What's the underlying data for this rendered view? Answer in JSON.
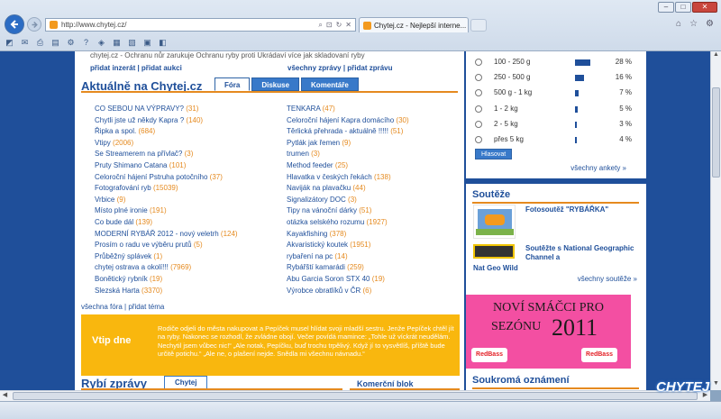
{
  "browser": {
    "url": "http://www.chytej.cz/",
    "tab_title": "Chytej.cz - Nejlepší interne...",
    "tab_close": "×",
    "win_min": "–",
    "win_max": "□",
    "win_close": "✕"
  },
  "main": {
    "top_strip": "chytej.cz - Ochranu nůr zarukuje Ochranu ryby proti Ukrádaví více jak skladovaní ryby",
    "top_left_links": "přidat inzerát | přidat aukci",
    "top_right_links": "všechny zprávy | přidat zprávu",
    "section_title": "Aktuálně na Chytej.cz",
    "tabs": [
      {
        "label": "Fóra"
      },
      {
        "label": "Diskuse"
      },
      {
        "label": "Komentáře"
      }
    ],
    "topics_left": [
      {
        "t": "CO SEBOU NA VÝPRAVY?",
        "c": "(31)"
      },
      {
        "t": "Chytli jste už někdy Kapra ?",
        "c": "(140)"
      },
      {
        "t": "Řipka a spol.",
        "c": "(684)"
      },
      {
        "t": "Vtipy",
        "c": "(2006)"
      },
      {
        "t": "Se Streamerem na přívlač?",
        "c": "(3)"
      },
      {
        "t": "Pruty Shimano Catana",
        "c": "(101)"
      },
      {
        "t": "Celoroční hájení Pstruha potočního",
        "c": "(37)"
      },
      {
        "t": "Fotografování ryb",
        "c": "(15039)"
      },
      {
        "t": "Vrbice",
        "c": "(9)"
      },
      {
        "t": "Místo plné ironie",
        "c": "(191)"
      },
      {
        "t": "Co bude dál",
        "c": "(139)"
      },
      {
        "t": "MODERNÍ RYBÁŘ 2012 - nový veletrh",
        "c": "(124)"
      },
      {
        "t": "Prosím o radu ve výběru prutů",
        "c": "(5)"
      },
      {
        "t": "Průběžný splávek",
        "c": "(1)"
      },
      {
        "t": "chytej ostrava a okolí!!!",
        "c": "(7969)"
      },
      {
        "t": "Bonětický rybník",
        "c": "(19)"
      },
      {
        "t": "Slezská Harta",
        "c": "(3370)"
      }
    ],
    "topics_right": [
      {
        "t": "TENKARA",
        "c": "(47)"
      },
      {
        "t": "Celoroční hájení Kapra domácího",
        "c": "(30)"
      },
      {
        "t": "Těrlická přehrada - aktuálně !!!!!",
        "c": "(51)"
      },
      {
        "t": "Pytlák jak řemen",
        "c": "(9)"
      },
      {
        "t": "trumen",
        "c": "(3)"
      },
      {
        "t": "Method feeder",
        "c": "(25)"
      },
      {
        "t": "Hlavatka v českých řekách",
        "c": "(138)"
      },
      {
        "t": "Naviják na plavačku",
        "c": "(44)"
      },
      {
        "t": "Signalizátory DOC",
        "c": "(3)"
      },
      {
        "t": "Tipy na vánoční dárky",
        "c": "(51)"
      },
      {
        "t": "otázka selského rozumu",
        "c": "(1927)"
      },
      {
        "t": "Kayakfishing",
        "c": "(378)"
      },
      {
        "t": "Akvaristický koutek",
        "c": "(1951)"
      },
      {
        "t": "rybaření na pc",
        "c": "(14)"
      },
      {
        "t": "Rybářští kamarádi",
        "c": "(259)"
      },
      {
        "t": "Abu Garcia Soron STX 40",
        "c": "(19)"
      },
      {
        "t": "Výrobce obratlíků v ČR",
        "c": "(6)"
      }
    ],
    "fora_links": "všechna fóra | přidat téma",
    "vtip_heading": "Vtip dne",
    "vtip_text": "Rodiče odjeli do města nakupovat a Pepíček musel hlídat svoji mladší sestru. Jenže Pepíček chtěl jít na ryby. Nakonec se rozhodl, že zvládne obojí. Večer povídá mamince: „Tohle už víckrát neudělám. Nechytil jsem vůbec nic!“ „Ale notak, Pepíčku, buď trochu trpělivý. Když jí to vysvětlíš, příště bude určitě potichu.“ „Ale ne, o plašení nejde. Snědla mi všechnu návnadu.“",
    "rybi_title": "Rybí zprávy",
    "rybi_tab": "Chytej",
    "komerc_title": "Komerční blok"
  },
  "sidebar": {
    "poll": [
      {
        "label": "100 - 250 g",
        "pct": 28,
        "pct_label": "28 %"
      },
      {
        "label": "250 - 500 g",
        "pct": 16,
        "pct_label": "16 %"
      },
      {
        "label": "500 g - 1 kg",
        "pct": 7,
        "pct_label": "7 %"
      },
      {
        "label": "1 - 2 kg",
        "pct": 5,
        "pct_label": "5 %"
      },
      {
        "label": "2 - 5 kg",
        "pct": 3,
        "pct_label": "3 %"
      },
      {
        "label": "přes 5 kg",
        "pct": 4,
        "pct_label": "4 %"
      }
    ],
    "vote_button": "Hlasovat",
    "all_polls": "všechny ankety »",
    "souteze_title": "Soutěže",
    "s1": "Fotosoutěž \"RYBÁŘKA\"",
    "s2a": "Soutěžte s National Geographic Channel a",
    "s2b": "Nat Geo Wild",
    "all_souteze": "všechny soutěže »",
    "banner_l1": "NOVÍ SMÁČCI PRO",
    "banner_l2": "SEZÓNU",
    "banner_year": "2011",
    "banner_logo": "RedBass",
    "souk_title": "Soukromá oznámení"
  },
  "watermark": "CHYTEJ"
}
